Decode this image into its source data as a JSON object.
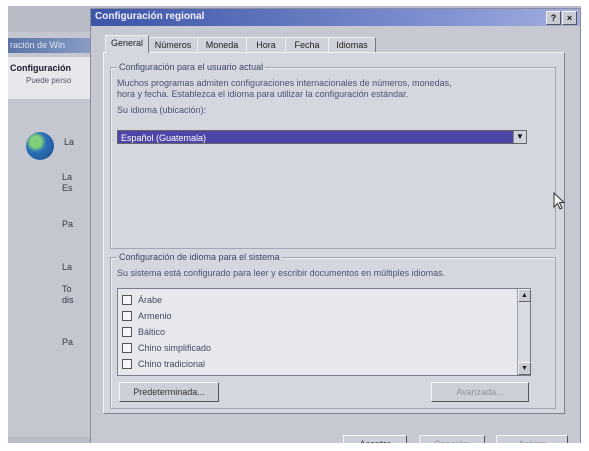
{
  "background_window": {
    "title": "ración de Win",
    "header_title": "Configuración",
    "header_subtitle": "Puede perso",
    "labels": [
      "La",
      "La",
      "Es",
      "Pa",
      "La",
      "To",
      "dis",
      "Pa"
    ]
  },
  "dialog": {
    "title": "Configuración regional",
    "help_button": "?",
    "close_button": "×",
    "tabs": [
      "General",
      "Números",
      "Moneda",
      "Hora",
      "Fecha",
      "Idiomas"
    ],
    "active_tab": "General",
    "user_settings": {
      "group_label": "Configuración para el usuario actual",
      "description_line1": "Muchos programas admiten configuraciones internacionales de números, monedas,",
      "description_line2": "hora y fecha. Establezca el idioma para utilizar la configuración estándar.",
      "locale_label": "Su idioma (ubicación):",
      "locale_value": "Español (Guatemala)"
    },
    "system_settings": {
      "group_label": "Configuración de idioma para el sistema",
      "description": "Su sistema está configurado para leer y escribir documentos en múltiples idiomas.",
      "languages": [
        {
          "label": "Árabe",
          "checked": false
        },
        {
          "label": "Armenio",
          "checked": false
        },
        {
          "label": "Báltico",
          "checked": false
        },
        {
          "label": "Chino simplificado",
          "checked": false
        },
        {
          "label": "Chino tradicional",
          "checked": false
        }
      ],
      "default_button": "Predeterminada...",
      "advanced_button": "Avanzada..."
    },
    "footer": {
      "ok": "Aceptar",
      "cancel": "Cancelar",
      "apply": "Aplicar"
    }
  },
  "colors": {
    "titlebar": "#3c55a8",
    "selection": "#4d46a8",
    "dialog_face": "#c6c9d2"
  }
}
